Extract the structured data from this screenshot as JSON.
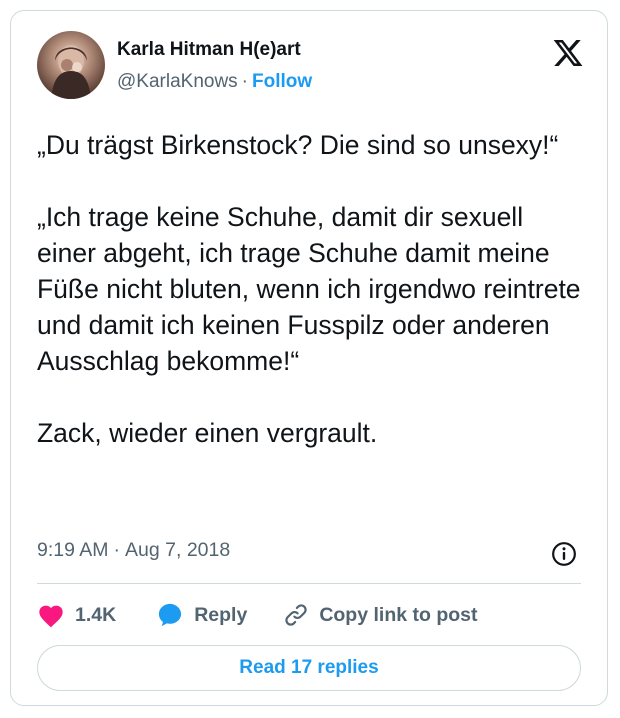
{
  "author": {
    "display_name": "Karla Hitman H(e)art",
    "handle": "@KarlaKnows",
    "follow_label": "Follow"
  },
  "tweet": {
    "text": "„Du trägst Birkenstock? Die sind so unsexy!“\n\n„Ich trage keine Schuhe, damit dir sexuell einer abgeht, ich trage Schuhe damit meine Füße nicht bluten, wenn ich irgendwo reintrete und damit ich keinen Fusspilz oder anderen Ausschlag bekomme!“\n\nZack, wieder einen vergrault.",
    "time": "9:19 AM",
    "date": "Aug 7, 2018"
  },
  "actions": {
    "likes": "1.4K",
    "reply_label": "Reply",
    "copy_link_label": "Copy link to post"
  },
  "read_replies_label": "Read 17 replies",
  "icons": {
    "platform": "x-logo-icon",
    "info": "info-icon",
    "like": "heart-icon",
    "reply": "speech-bubble-icon",
    "copy": "link-icon"
  },
  "colors": {
    "accent": "#1d9bf0",
    "heart": "#f91880",
    "text": "#0f1419",
    "secondary": "#536471",
    "border": "#cfd9de"
  }
}
